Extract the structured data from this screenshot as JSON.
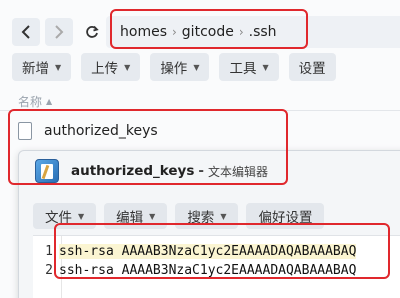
{
  "navigation": {
    "breadcrumb": [
      "homes",
      "gitcode",
      ".ssh"
    ]
  },
  "toolbar": {
    "buttons": [
      {
        "label": "新增"
      },
      {
        "label": "上传"
      },
      {
        "label": "操作"
      },
      {
        "label": "工具"
      },
      {
        "label": "设置"
      }
    ]
  },
  "file_list": {
    "column_name": "名称",
    "files": [
      {
        "name": "authorized_keys"
      }
    ]
  },
  "editor": {
    "title": "authorized_keys",
    "title_separator": "-",
    "app_name": "文本编辑器",
    "menu": [
      {
        "label": "文件",
        "has_caret": true
      },
      {
        "label": "编辑",
        "has_caret": true
      },
      {
        "label": "搜索",
        "has_caret": true
      },
      {
        "label": "偏好设置",
        "has_caret": false
      }
    ],
    "lines": [
      {
        "num": "1",
        "text": "ssh-rsa AAAAB3NzaC1yc2EAAAADAQABAAABAQ"
      },
      {
        "num": "2",
        "text": "ssh-rsa AAAAB3NzaC1yc2EAAAADAQABAAABAQ"
      }
    ]
  },
  "colors": {
    "highlight": "#e0282d",
    "current_line": "#fbf5d2"
  }
}
